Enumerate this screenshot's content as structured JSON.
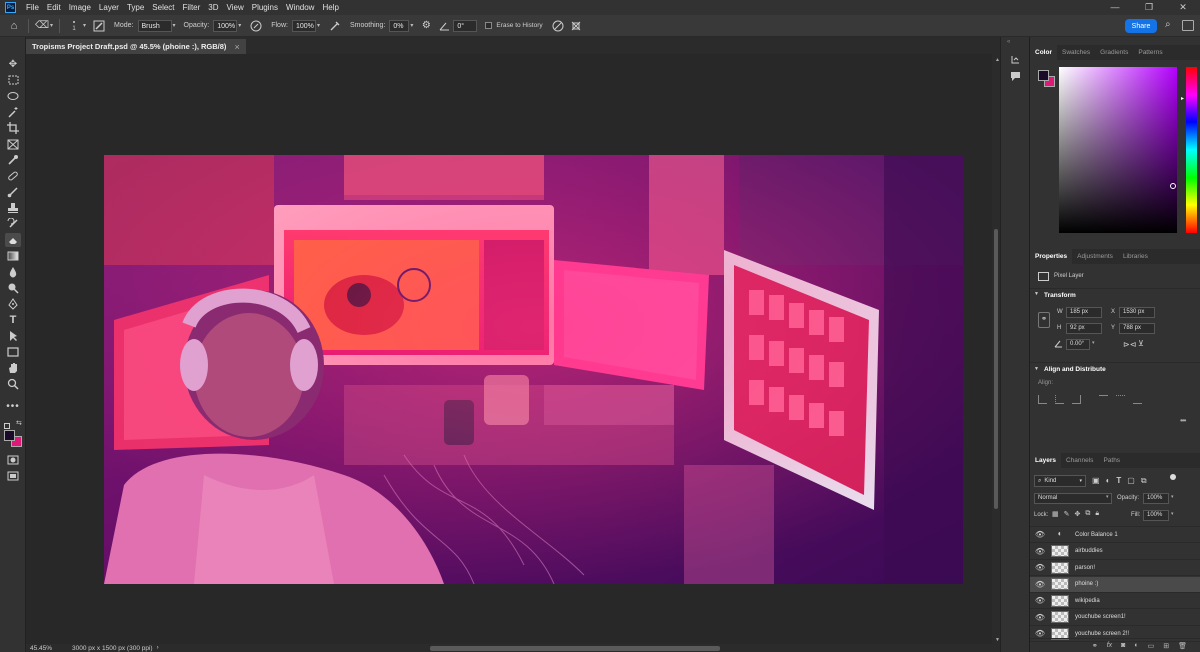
{
  "app": {
    "logo": "Ps"
  },
  "menu": [
    "File",
    "Edit",
    "Image",
    "Layer",
    "Type",
    "Select",
    "Filter",
    "3D",
    "View",
    "Plugins",
    "Window",
    "Help"
  ],
  "window_controls": [
    "—",
    "❐",
    "✕"
  ],
  "options_bar": {
    "brush_size": "1",
    "mode_label": "Mode:",
    "mode_value": "Brush",
    "opacity_label": "Opacity:",
    "opacity_value": "100%",
    "flow_label": "Flow:",
    "flow_value": "100%",
    "smoothing_label": "Smoothing:",
    "smoothing_value": "0%",
    "angle_value": "0°",
    "erase_history_label": "Erase to History",
    "share_label": "Share"
  },
  "document": {
    "tab_title": "Tropisms Project Draft.psd @ 45.5% (phoine :), RGB/8)",
    "tab_close": "×",
    "zoom": "45.45%",
    "dimensions": "3000 px x 1500 px (300 ppi)"
  },
  "color_panel": {
    "tabs": [
      "Color",
      "Swatches",
      "Gradients",
      "Patterns"
    ],
    "foreground": "#1a0a2a",
    "background": "#e0187a",
    "hue_color": "#b400ff"
  },
  "properties_panel": {
    "tabs": [
      "Properties",
      "Adjustments",
      "Libraries"
    ],
    "kind": "Pixel Layer",
    "transform_label": "Transform",
    "w_label": "W",
    "w_value": "185 px",
    "h_label": "H",
    "h_value": "92 px",
    "x_label": "X",
    "x_value": "1530 px",
    "y_label": "Y",
    "y_value": "788 px",
    "angle_value": "0.00°",
    "align_label": "Align and Distribute",
    "align_sub": "Align:"
  },
  "layers_panel": {
    "tabs": [
      "Layers",
      "Channels",
      "Paths"
    ],
    "filter_kind": "Kind",
    "blend_mode": "Normal",
    "opacity_label": "Opacity:",
    "opacity_value": "100%",
    "lock_label": "Lock:",
    "fill_label": "Fill:",
    "fill_value": "100%",
    "layers": [
      {
        "name": "Color Balance 1",
        "selected": false
      },
      {
        "name": "airbuddies",
        "selected": false
      },
      {
        "name": "parson!",
        "selected": false
      },
      {
        "name": "phoine :)",
        "selected": true
      },
      {
        "name": "wikipedia",
        "selected": false
      },
      {
        "name": "youchube screen1!",
        "selected": false
      },
      {
        "name": "youchube screen 2!!",
        "selected": false
      }
    ],
    "footer_icons": [
      "link-icon",
      "fx-icon",
      "mask-icon",
      "adjustment-icon",
      "folder-icon",
      "new-layer-icon",
      "trash-icon"
    ]
  }
}
